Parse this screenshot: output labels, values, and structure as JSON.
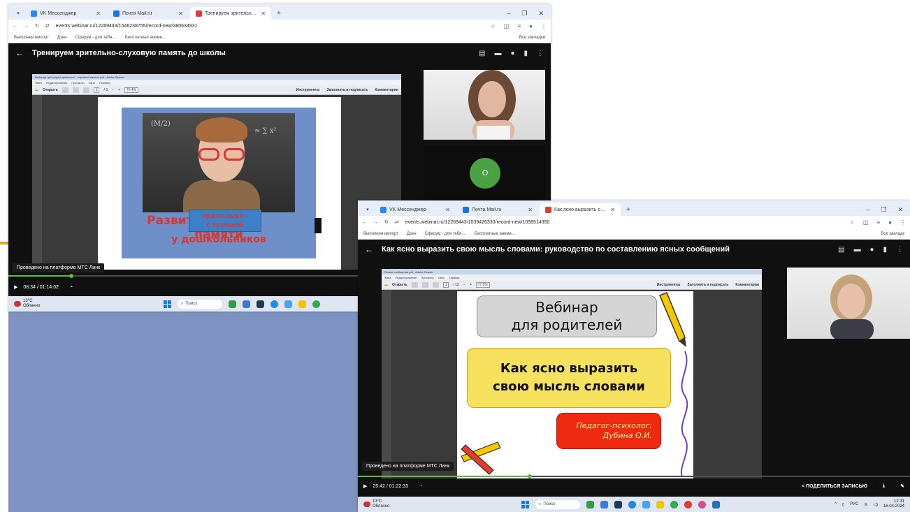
{
  "window1": {
    "tabs": [
      {
        "label": "VK Мессенджер",
        "color": "#2787f5"
      },
      {
        "label": "Почта Mail.ru",
        "color": "#1c72e8"
      },
      {
        "label": "Тренируем зрительно-слухово",
        "color": "#e53935"
      }
    ],
    "url": "events.webinar.ru/12269443/1546238755/record-new/380634931",
    "bookmarks": [
      "Выполнен импорт",
      "Дзен",
      "Сферум - для тебя,...",
      "Бесплатные аниме..."
    ],
    "all_bookmarks": "Все закладки",
    "title": "Тренируем зрительно-слуховую память до школы",
    "adobe_title": "Вебинар тренируем зрительно - слуховой памяти.pdf - Adobe Reader",
    "adobe_menu": [
      "Файл",
      "Редактирование",
      "Просмотр",
      "Окно",
      "Справка"
    ],
    "adobe_open": "Открыть",
    "adobe_page": "1",
    "adobe_total": "/ 6",
    "adobe_zoom": "76,4%",
    "adobe_right": [
      "Инструменты",
      "Заполнить и подписать",
      "Комментарии"
    ],
    "slide": {
      "word1": "Развитие",
      "box": "зрительно - слуховой",
      "word2": "памяти",
      "line2": "у дошкольников",
      "chalk1": "(M/2)",
      "chalk2": "≈ ∑ x²"
    },
    "avatar_letter": "O",
    "platform": "Проведено на платформе МТС Линк",
    "time": "08:34 / 01:14:02",
    "progress": 0.116,
    "weather_temp": "13°C",
    "weather_desc": "Облачно",
    "search": "Поиск"
  },
  "window2": {
    "tabs": [
      {
        "label": "VK Мессенджер",
        "color": "#2787f5"
      },
      {
        "label": "Почта Mail.ru",
        "color": "#1c72e8"
      },
      {
        "label": "Как ясно выразить свою мысл",
        "color": "#e53935"
      }
    ],
    "url": "events.webinar.ru/12269443/1039426330/record-new/1058514350",
    "bookmarks": [
      "Выполнен импорт",
      "Дзен",
      "Сферум - для тебя,...",
      "Бесплатные аниме..."
    ],
    "all_bookmarks": "Все закладк",
    "title": "Как ясно выразить свою мысль словами: руководство по составлению ясных сообщений",
    "adobe_title": "Ясные сообщения.pdf - Adobe Reader",
    "adobe_menu": [
      "Файл",
      "Редактирование",
      "Просмотр",
      "Окно",
      "Справка"
    ],
    "adobe_open": "Открыть",
    "adobe_page": "1",
    "adobe_total": "/ 12",
    "adobe_zoom": "77,5%",
    "adobe_right": [
      "Инструменты",
      "Заполнить и подписать",
      "Комментарии"
    ],
    "slide": {
      "line1": "Вебинар",
      "line2": "для родителей",
      "line3": "Как ясно выразить",
      "line4": "свою мысль словами",
      "line5": "Педагог-психолог:",
      "line6": "Дубина О.И."
    },
    "platform": "Проведено на платформе МТС Линк",
    "time": "25:42 / 01:22:33",
    "progress": 0.311,
    "share": "ПОДЕЛИТЬСЯ ЗАПИСЬЮ",
    "weather_temp": "13°C",
    "weather_desc": "Облачно",
    "search": "Поиск",
    "lang": "РУС",
    "clock_time": "12:31",
    "clock_date": "16.04.2024"
  }
}
